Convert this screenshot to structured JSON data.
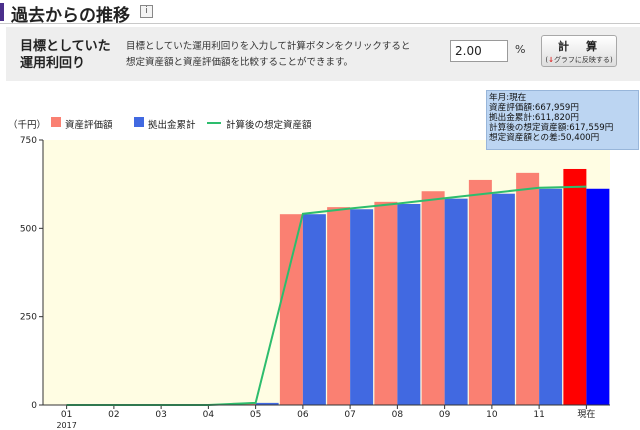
{
  "header": {
    "title": "過去からの推移",
    "info_icon": "info-icon",
    "info_glyph": "i"
  },
  "panel": {
    "label_line1": "目標としていた",
    "label_line2": "運用利回り",
    "description_line1": "目標としていた運用利回りを入力して計算ボタンをクリックすると",
    "description_line2": "想定資産額と資産評価額を比較することができます。",
    "rate_value": "2.00",
    "rate_unit": "%",
    "calc_button_label": "計　算",
    "calc_button_sub": "グラフに反映する",
    "calc_button_arrow": "↓"
  },
  "tooltip": {
    "line1": "年月:現在",
    "line2": "資産評価額:667,959円",
    "line3": "拠出金累計:611,820円",
    "line4": "計算後の想定資産額:617,559円",
    "line5": "想定資産額との差:50,400円"
  },
  "chart_data": {
    "type": "bar",
    "unit_label": "（千円）",
    "categories": [
      "01",
      "02",
      "03",
      "04",
      "05",
      "06",
      "07",
      "08",
      "09",
      "10",
      "11",
      "現在"
    ],
    "year_label": "2017",
    "series": [
      {
        "name": "資産評価額",
        "kind": "bar",
        "color": "#fa8072",
        "highlight_color": "#ff0000",
        "values": [
          0,
          0,
          0,
          0,
          6,
          540,
          560,
          575,
          605,
          637,
          657,
          668
        ]
      },
      {
        "name": "拠出金累計",
        "kind": "bar",
        "color": "#4169e1",
        "highlight_color": "#0000ff",
        "values": [
          0,
          0,
          0,
          0,
          6,
          540,
          554,
          569,
          584,
          598,
          612,
          612
        ]
      },
      {
        "name": "計算後の想定資産額",
        "kind": "line",
        "color": "#2dbd6d",
        "values": [
          0,
          0,
          0,
          0,
          6,
          541,
          556,
          570,
          585,
          600,
          615,
          618
        ]
      }
    ],
    "ylim": [
      0,
      750
    ],
    "yticks": [
      0,
      250,
      500,
      750
    ],
    "plot_background": "#fffde3",
    "grid": false,
    "legend_position": "top-left"
  }
}
